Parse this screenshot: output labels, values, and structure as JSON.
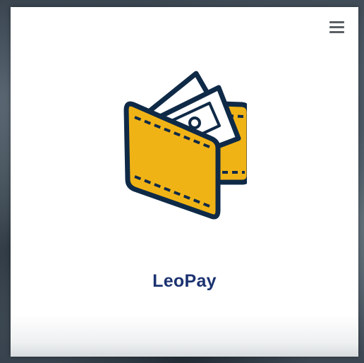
{
  "app": {
    "name": "LeoPay",
    "icon": "wallet-icon"
  },
  "menu": {
    "icon": "hamburger-menu-icon"
  },
  "colors": {
    "tile_background": "#ffffff",
    "wallet_fill": "#f0b316",
    "wallet_outline": "#0f2a47",
    "app_name": "#1b3270",
    "menu_icon": "#5a5f63"
  }
}
